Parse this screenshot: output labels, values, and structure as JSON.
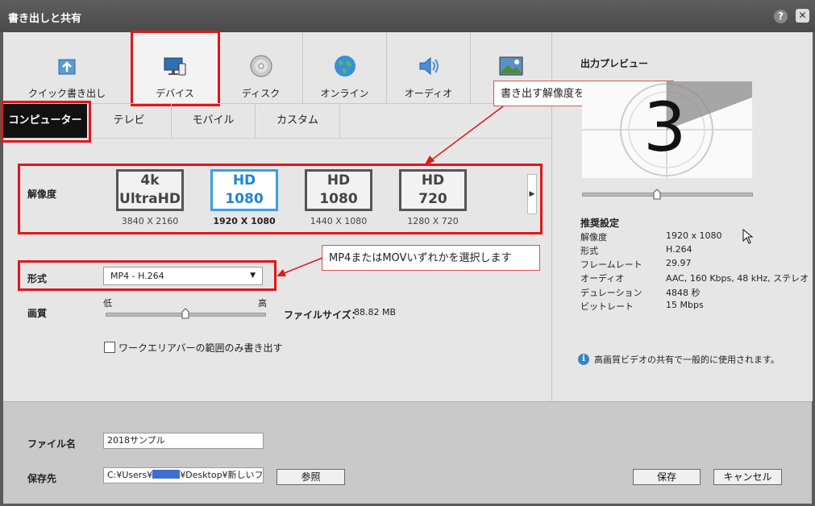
{
  "window": {
    "title": "書き出しと共有",
    "help": "?",
    "close": "✕"
  },
  "top_tabs": {
    "quick_export": "クイック書き出し",
    "device": "デバイス",
    "disc": "ディスク",
    "online": "オンライン",
    "audio": "オーディオ"
  },
  "sub_tabs": {
    "computer": "コンピューター",
    "tv": "テレビ",
    "mobile": "モバイル",
    "custom": "カスタム"
  },
  "resolution": {
    "label": "解像度",
    "tiles": [
      {
        "line1": "4k",
        "line2": "UltraHD",
        "dims": "3840 X 2160",
        "selected": false
      },
      {
        "line1": "HD",
        "line2": "1080",
        "dims": "1920 X 1080",
        "selected": true
      },
      {
        "line1": "HD",
        "line2": "1080",
        "dims": "1440 X 1080",
        "selected": false
      },
      {
        "line1": "HD",
        "line2": "720",
        "dims": "1280 X 720",
        "selected": false
      }
    ],
    "next_arrow": "▶"
  },
  "callouts": {
    "resolution": "書き出す解像度を選択します",
    "format": "MP4またはMOVいずれかを選択します"
  },
  "format": {
    "label": "形式",
    "value": "MP4 - H.264",
    "caret": "▼"
  },
  "quality": {
    "label": "画質",
    "low": "低",
    "high": "高",
    "level_fraction": 0.5
  },
  "filesize": {
    "label": "ファイルサイズ：",
    "value": "88.82 MB"
  },
  "workarea": {
    "label": "ワークエリアバーの範囲のみ書き出す",
    "checked": false
  },
  "preview": {
    "title": "出力プレビュー",
    "countdown": "3",
    "position_fraction": 0.45
  },
  "recommended": {
    "title": "推奨設定",
    "rows": [
      {
        "label": "解像度",
        "value": "1920 x 1080"
      },
      {
        "label": "形式",
        "value": "H.264"
      },
      {
        "label": "フレームレート",
        "value": "29.97"
      },
      {
        "label": "オーディオ",
        "value": "AAC, 160 Kbps, 48 kHz, ステレオ"
      },
      {
        "label": "デュレーション",
        "value": "4848 秒"
      },
      {
        "label": "ビットレート",
        "value": "15 Mbps"
      }
    ],
    "info": "高画質ビデオの共有で一般的に使用されます。"
  },
  "bottom": {
    "filename_label": "ファイル名",
    "filename_value": "2018サンプル",
    "dest_label": "保存先",
    "dest_value_prefix": "C:¥Users¥",
    "dest_value_suffix": "¥Desktop¥新しいフォル",
    "browse": "参照",
    "save": "保存",
    "cancel": "キャンセル"
  },
  "colors": {
    "accent_red": "#e0161c",
    "selected_blue": "#39a0e6",
    "masked": "#3d6fd0"
  }
}
